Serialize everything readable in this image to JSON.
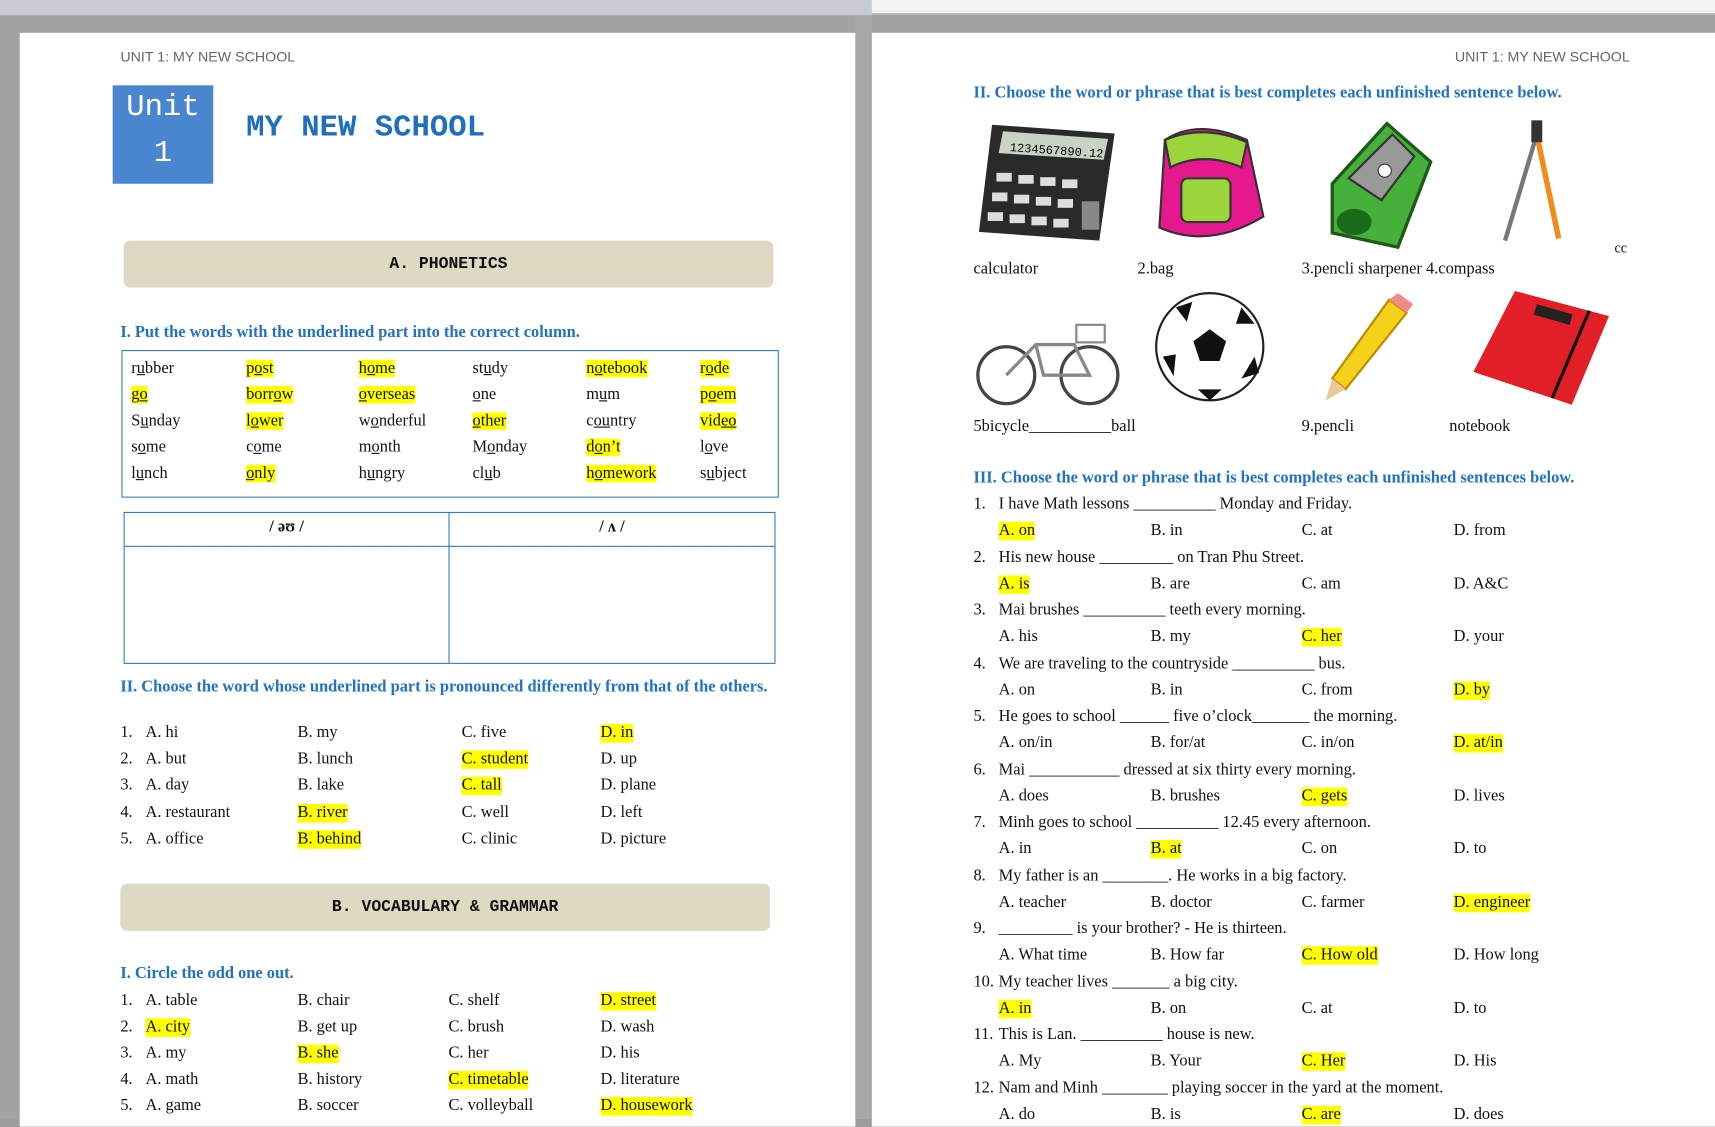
{
  "header": "UNIT 1: MY NEW SCHOOL",
  "unit": {
    "word": "Unit",
    "number": "1",
    "title": "MY NEW SCHOOL"
  },
  "sectionA": "A.  PHONETICS",
  "sectionB": "B.  VOCABULARY  &  GRAMMAR",
  "phon1": {
    "heading": "I. Put the words with the underlined part into the correct column.",
    "rows": [
      [
        {
          "a": "r",
          "u": "u",
          "b": "bber"
        },
        {
          "a": "p",
          "u": "o",
          "b": "st",
          "hl": true
        },
        {
          "a": "h",
          "u": "o",
          "b": "me",
          "hl": true
        },
        {
          "a": "st",
          "u": "u",
          "b": "dy"
        },
        {
          "a": "n",
          "u": "o",
          "b": "tebook",
          "hl": true
        },
        {
          "a": "r",
          "u": "o",
          "b": "de",
          "hl": true
        }
      ],
      [
        {
          "a": "g",
          "u": "o",
          "b": "",
          "hl": true
        },
        {
          "a": "borr",
          "u": "o",
          "b": "w",
          "hl": true
        },
        {
          "a": "",
          "u": "o",
          "b": "verseas",
          "hl": true
        },
        {
          "a": "",
          "u": "o",
          "b": "ne"
        },
        {
          "a": "m",
          "u": "u",
          "b": "m"
        },
        {
          "a": "p",
          "u": "o",
          "b": "em",
          "hl": true
        }
      ],
      [
        {
          "a": "S",
          "u": "u",
          "b": "nday"
        },
        {
          "a": "l",
          "u": "o",
          "b": "wer",
          "hl": true
        },
        {
          "a": "w",
          "u": "o",
          "b": "nderful"
        },
        {
          "a": "",
          "u": "o",
          "b": "ther",
          "hl": true
        },
        {
          "a": "c",
          "u": "ou",
          "b": "ntry"
        },
        {
          "a": "vid",
          "u": "eo",
          "b": "",
          "hl": true
        }
      ],
      [
        {
          "a": "s",
          "u": "o",
          "b": "me"
        },
        {
          "a": "c",
          "u": "o",
          "b": "me"
        },
        {
          "a": "m",
          "u": "o",
          "b": "nth"
        },
        {
          "a": "M",
          "u": "o",
          "b": "nday"
        },
        {
          "a": "d",
          "u": "o",
          "b": "n’t",
          "hl": true
        },
        {
          "a": "l",
          "u": "o",
          "b": "ve"
        }
      ],
      [
        {
          "a": "l",
          "u": "u",
          "b": "nch"
        },
        {
          "a": "",
          "u": "o",
          "b": "nly",
          "hl": true
        },
        {
          "a": "h",
          "u": "u",
          "b": "ngry"
        },
        {
          "a": "cl",
          "u": "u",
          "b": "b"
        },
        {
          "a": "h",
          "u": "o",
          "b": "mework",
          "hl": true
        },
        {
          "a": "s",
          "u": "u",
          "b": "bject"
        }
      ]
    ],
    "columns": [
      "/ əʊ /",
      "/ ʌ /"
    ]
  },
  "phon2": {
    "heading": "II.  Choose  the  word  whose  underlined  part  is  pronounced  differently  from  that  of  the others.",
    "items": [
      {
        "n": "1.",
        "o": [
          [
            "A. hi",
            false
          ],
          [
            "B. my",
            false
          ],
          [
            "C. five",
            false
          ],
          [
            "D. in",
            true
          ]
        ]
      },
      {
        "n": "2.",
        "o": [
          [
            "A. but",
            false
          ],
          [
            "B. lunch",
            false
          ],
          [
            "C. student",
            true
          ],
          [
            "D. up",
            false
          ]
        ]
      },
      {
        "n": "3.",
        "o": [
          [
            "A. day",
            false
          ],
          [
            "B. lake",
            false
          ],
          [
            "C. tall",
            true
          ],
          [
            "D. plane",
            false
          ]
        ]
      },
      {
        "n": "4.",
        "o": [
          [
            "A. restaurant",
            false
          ],
          [
            "B. river",
            true
          ],
          [
            "C. well",
            false
          ],
          [
            "D. left",
            false
          ]
        ]
      },
      {
        "n": "5.",
        "o": [
          [
            "A. office",
            false
          ],
          [
            "B. behind",
            true
          ],
          [
            "C. clinic",
            false
          ],
          [
            "D. picture",
            false
          ]
        ]
      }
    ]
  },
  "vocab1": {
    "heading": "I. Circle the odd one out.",
    "items": [
      {
        "n": "1.",
        "o": [
          [
            "A. table",
            false
          ],
          [
            "B. chair",
            false
          ],
          [
            "C. shelf",
            false
          ],
          [
            "D. street",
            true
          ]
        ]
      },
      {
        "n": "2.",
        "o": [
          [
            "A. city",
            true
          ],
          [
            "B. get up",
            false
          ],
          [
            "C. brush",
            false
          ],
          [
            "D. wash",
            false
          ]
        ]
      },
      {
        "n": "3.",
        "o": [
          [
            "A. my",
            false
          ],
          [
            "B. she",
            true
          ],
          [
            "C. her",
            false
          ],
          [
            "D. his",
            false
          ]
        ]
      },
      {
        "n": "4.",
        "o": [
          [
            "A. math",
            false
          ],
          [
            "B. history",
            false
          ],
          [
            "C. timetable",
            true
          ],
          [
            "D. literature",
            false
          ]
        ]
      },
      {
        "n": "5.",
        "o": [
          [
            "A. game",
            false
          ],
          [
            "B. soccer",
            false
          ],
          [
            "C. volleyball",
            false
          ],
          [
            "D. housework",
            true
          ]
        ]
      }
    ]
  },
  "vocab2": {
    "heading": "II. Choose the word or phrase that is best completes each unfinished sentence below.",
    "labels1": [
      "calculator",
      "2.bag",
      "3.pencli sharpener 4.compass"
    ],
    "extra": "cc",
    "labels2": [
      "5bicycle__________ball",
      "9.pencli",
      "notebook"
    ],
    "calculator_display": "1234567890.12"
  },
  "vocab3": {
    "heading": "III. Choose the word or phrase that is best completes each unfinished sentences below.",
    "items": [
      {
        "n": "1.",
        "q": "I have Math lessons __________ Monday and Friday.",
        "o": [
          [
            "A. on",
            true
          ],
          [
            "B. in",
            false
          ],
          [
            "C. at",
            false
          ],
          [
            "D. from",
            false
          ]
        ]
      },
      {
        "n": "2.",
        "q": "His new house _________ on Tran Phu Street.",
        "o": [
          [
            "A. is",
            true
          ],
          [
            "B. are",
            false
          ],
          [
            "C. am",
            false
          ],
          [
            "D. A&C",
            false
          ]
        ]
      },
      {
        "n": "3.",
        "q": "Mai brushes __________ teeth every morning.",
        "o": [
          [
            "A. his",
            false
          ],
          [
            "B. my",
            false
          ],
          [
            "C. her",
            true
          ],
          [
            "D. your",
            false
          ]
        ]
      },
      {
        "n": "4.",
        "q": "We are traveling to the countryside __________ bus.",
        "o": [
          [
            "A. on",
            false
          ],
          [
            "B. in",
            false
          ],
          [
            "C. from",
            false
          ],
          [
            "D. by",
            true
          ]
        ]
      },
      {
        "n": "5.",
        "q": "He goes to school ______ five o’clock_______ the morning.",
        "o": [
          [
            "A. on/in",
            false
          ],
          [
            "B. for/at",
            false
          ],
          [
            "C. in/on",
            false
          ],
          [
            "D. at/in",
            true
          ]
        ]
      },
      {
        "n": "6.",
        "q": "Mai ___________ dressed at six thirty every morning.",
        "o": [
          [
            "A. does",
            false
          ],
          [
            "B. brushes",
            false
          ],
          [
            "C. gets",
            true
          ],
          [
            "D. lives",
            false
          ]
        ]
      },
      {
        "n": "7.",
        "q": "Minh goes to school __________ 12.45 every afternoon.",
        "o": [
          [
            "A. in",
            false
          ],
          [
            "B. at",
            true
          ],
          [
            "C. on",
            false
          ],
          [
            "D. to",
            false
          ]
        ]
      },
      {
        "n": "8.",
        "q": "My father is an ________. He works in a big factory.",
        "o": [
          [
            "A. teacher",
            false
          ],
          [
            "B. doctor",
            false
          ],
          [
            "C. farmer",
            false
          ],
          [
            "D. engineer",
            true
          ]
        ]
      },
      {
        "n": "9.",
        "q": "_________ is your brother? - He is thirteen.",
        "o": [
          [
            "A. What time",
            false
          ],
          [
            "B. How far",
            false
          ],
          [
            "C. How old",
            true
          ],
          [
            "D. How long",
            false
          ]
        ]
      },
      {
        "n": "10.",
        "q": "My teacher lives _______ a big city.",
        "o": [
          [
            "A. in",
            true
          ],
          [
            "B. on",
            false
          ],
          [
            "C. at",
            false
          ],
          [
            "D. to",
            false
          ]
        ]
      },
      {
        "n": "11.",
        "q": "This is Lan. __________ house is new.",
        "o": [
          [
            "A. My",
            false
          ],
          [
            "B. Your",
            false
          ],
          [
            "C. Her",
            true
          ],
          [
            "D. His",
            false
          ]
        ]
      },
      {
        "n": "12.",
        "q": "Nam and Minh ________ playing soccer in the yard at the moment.",
        "o": [
          [
            "A. do",
            false
          ],
          [
            "B. is",
            false
          ],
          [
            "C. are",
            true
          ],
          [
            "D. does",
            false
          ]
        ]
      }
    ]
  },
  "colors": {
    "accent": "#1f72c4",
    "unitBox": "#4a86d0",
    "banner": "#ded9c3",
    "highlight": "#ffff00"
  }
}
